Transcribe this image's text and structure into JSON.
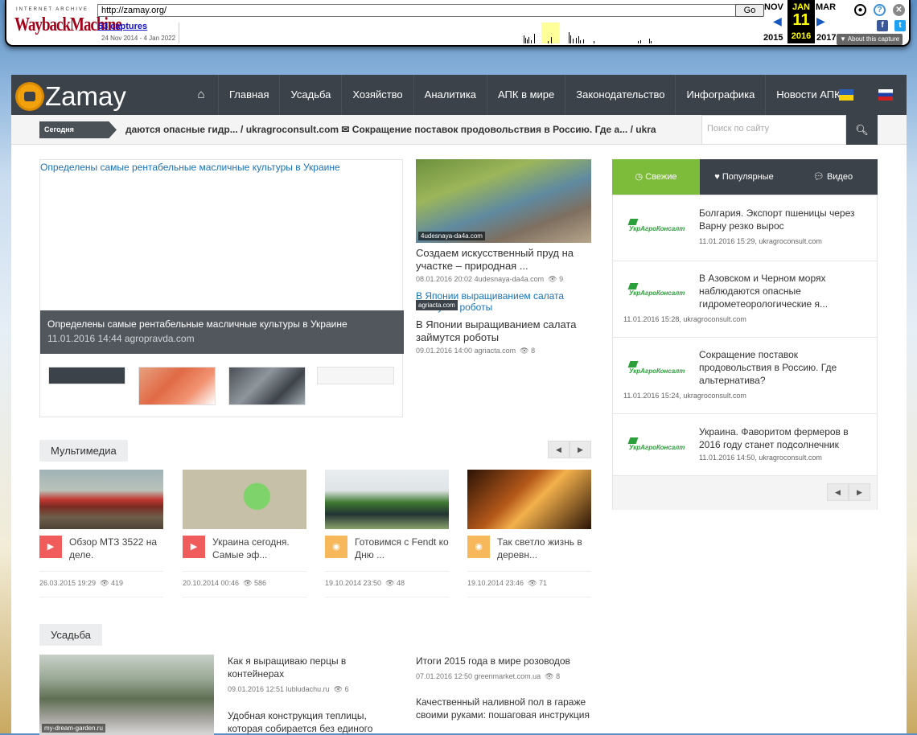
{
  "wayback": {
    "ia_label": "INTERNET ARCHIVE",
    "logo": "WaybackMachine",
    "url": "http://zamay.org/",
    "go": "Go",
    "captures": "53 captures",
    "range": "24 Nov 2014 - 4 Jan 2022",
    "prev_month": "NOV",
    "cur_month": "JAN",
    "cur_day": "11",
    "next_month": "MAR",
    "prev_year": "2015",
    "cur_year": "2016",
    "next_year": "2017",
    "about": "▼ About this capture"
  },
  "site": {
    "brand": "Zamay",
    "nav": [
      "Главная",
      "Усадьба",
      "Хозяйство",
      "Аналитика",
      "АПК в мире",
      "Законодательство",
      "Инфографика",
      "Новости АПК"
    ],
    "ticker_label": "Сегодня",
    "ticker_text": "даются опасные гидр... / ukragroconsult.com  ✉  Сокращение поставок продовольствия в Россию. Где а... / ukragroconsult.com",
    "search_placeholder": "Поиск по сайту"
  },
  "hero": {
    "alt": "Определены самые рентабельные масличные культуры в Украине",
    "title": "Определены самые рентабельные масличные культуры в Украине",
    "meta": "11.01.2016 14:44 agropravda.com"
  },
  "side_news": [
    {
      "source": "4udesnaya-da4a.com",
      "title": "Создаем искусственный пруд на участке – природная ...",
      "date": "08.01.2016 20:02",
      "site": "4udesnaya-da4a.com",
      "views": "9"
    },
    {
      "alt": "В Японии выращиванием салата займутся роботы",
      "source": "agriacta.com",
      "title": "В Японии выращиванием салата займутся роботы",
      "date": "09.01.2016 14:00",
      "site": "agriacta.com",
      "views": "8"
    }
  ],
  "multimedia": {
    "label": "Мультимедиа",
    "items": [
      {
        "title": "Обзор МТЗ 3522 на деле.",
        "date": "26.03.2015 19:29",
        "views": "419"
      },
      {
        "title": "Украина сегодня. Самые эф...",
        "date": "20.10.2014 00:46",
        "views": "586"
      },
      {
        "title": "Готовимся с Fendt ко Дню ...",
        "date": "19.10.2014 23:50",
        "views": "48"
      },
      {
        "title": "Так светло жизнь в деревн...",
        "date": "19.10.2014 23:46",
        "views": "71"
      }
    ]
  },
  "tabs": {
    "fresh": "Свежие",
    "popular": "Популярные",
    "video": "Видео"
  },
  "feed": [
    {
      "logo": "УкрАгроКонсалт",
      "title": "Болгария. Экспорт пшеницы через Варну резко вырос",
      "meta": "11.01.2016 15:29, ukragroconsult.com"
    },
    {
      "logo": "УкрАгроКонсалт",
      "title": "В Азовском и Черном морях наблюдаются опасные гидрометеорологические я...",
      "meta": "11.01.2016 15:28, ukragroconsult.com"
    },
    {
      "logo": "УкрАгроКонсалт",
      "title": "Сокращение поставок продовольствия в Россию. Где альтернатива?",
      "meta": "11.01.2016 15:24, ukragroconsult.com"
    },
    {
      "logo": "УкрАгроКонсалт",
      "title": "Украина. Фаворитом фермеров в 2016 году станет подсолнечник",
      "meta": "11.01.2016 14:50, ukragroconsult.com"
    }
  ],
  "usadba": {
    "label": "Усадьба",
    "img_source": "my-dream-garden.ru",
    "col1": [
      {
        "title": "Как я выращиваю перцы в контейнерах",
        "date": "09.01.2016 12:51",
        "site": "lubludachu.ru",
        "views": "6"
      },
      {
        "title": "Удобная конструкция теплицы, которая собирается без единого"
      }
    ],
    "col2": [
      {
        "title": "Итоги 2015 года в мире розоводов",
        "date": "07.01.2016 12:50",
        "site": "greenmarket.com.ua",
        "views": "8"
      },
      {
        "title": "Качественный наливной пол в гараже своими руками: пошаговая инструкция"
      }
    ]
  }
}
